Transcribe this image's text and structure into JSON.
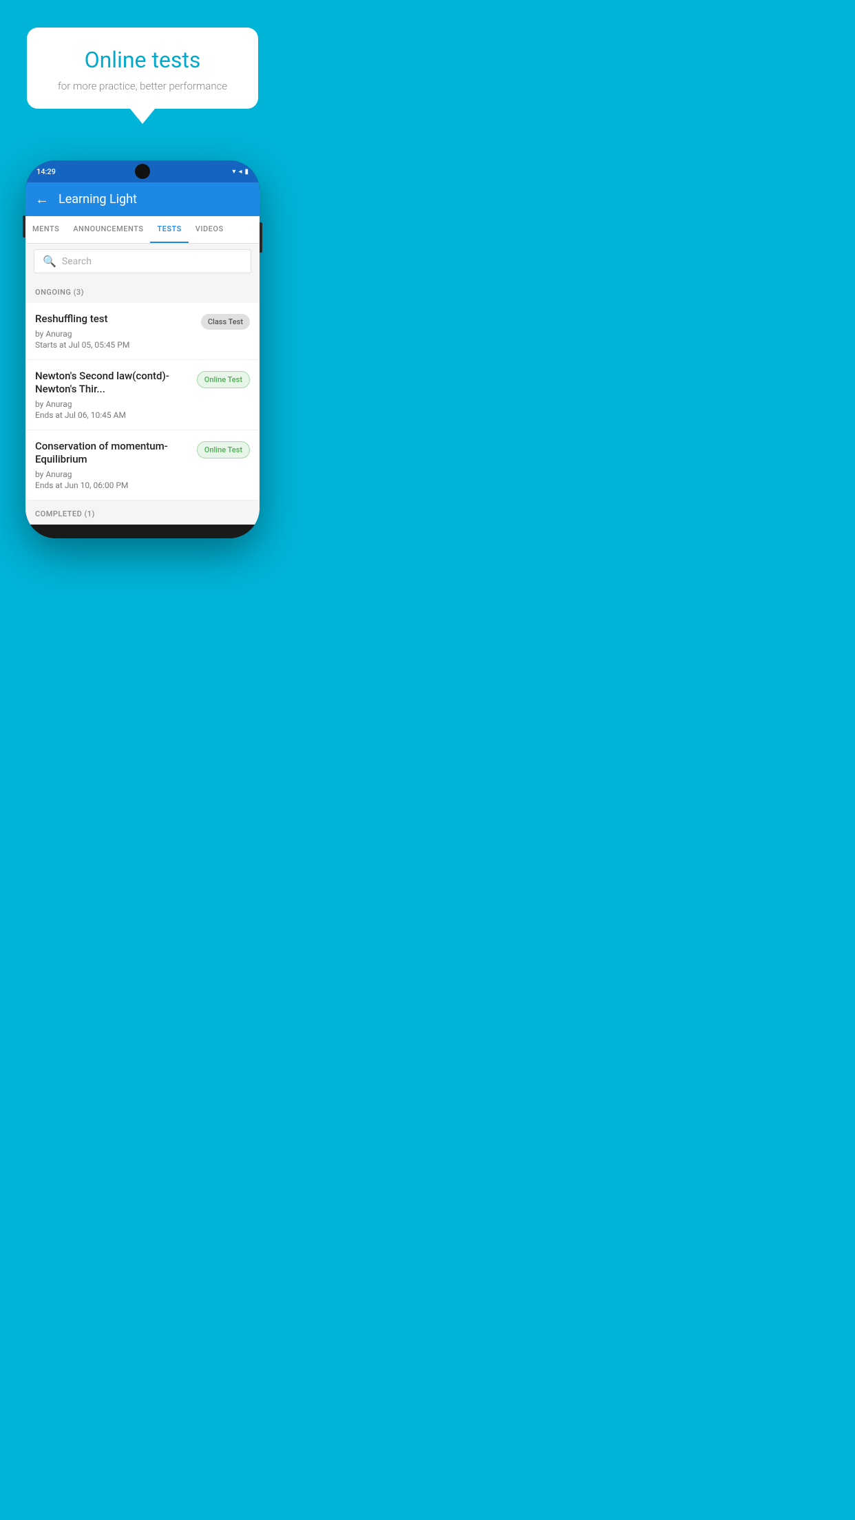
{
  "promo": {
    "title": "Online tests",
    "subtitle": "for more practice, better performance"
  },
  "status_bar": {
    "time": "14:29",
    "icons": [
      "wifi",
      "signal",
      "battery"
    ]
  },
  "header": {
    "title": "Learning Light",
    "back_label": "←"
  },
  "tabs": [
    {
      "id": "assignments",
      "label": "MENTS",
      "active": false
    },
    {
      "id": "announcements",
      "label": "ANNOUNCEMENTS",
      "active": false
    },
    {
      "id": "tests",
      "label": "TESTS",
      "active": true
    },
    {
      "id": "videos",
      "label": "VIDEOS",
      "active": false
    }
  ],
  "search": {
    "placeholder": "Search"
  },
  "ongoing_section": {
    "label": "ONGOING (3)"
  },
  "tests": [
    {
      "name": "Reshuffling test",
      "author": "by Anurag",
      "date": "Starts at  Jul 05, 05:45 PM",
      "badge": "Class Test",
      "badge_type": "class"
    },
    {
      "name": "Newton's Second law(contd)-Newton's Thir...",
      "author": "by Anurag",
      "date": "Ends at  Jul 06, 10:45 AM",
      "badge": "Online Test",
      "badge_type": "online"
    },
    {
      "name": "Conservation of momentum-Equilibrium",
      "author": "by Anurag",
      "date": "Ends at  Jun 10, 06:00 PM",
      "badge": "Online Test",
      "badge_type": "online"
    }
  ],
  "completed_section": {
    "label": "COMPLETED (1)"
  }
}
